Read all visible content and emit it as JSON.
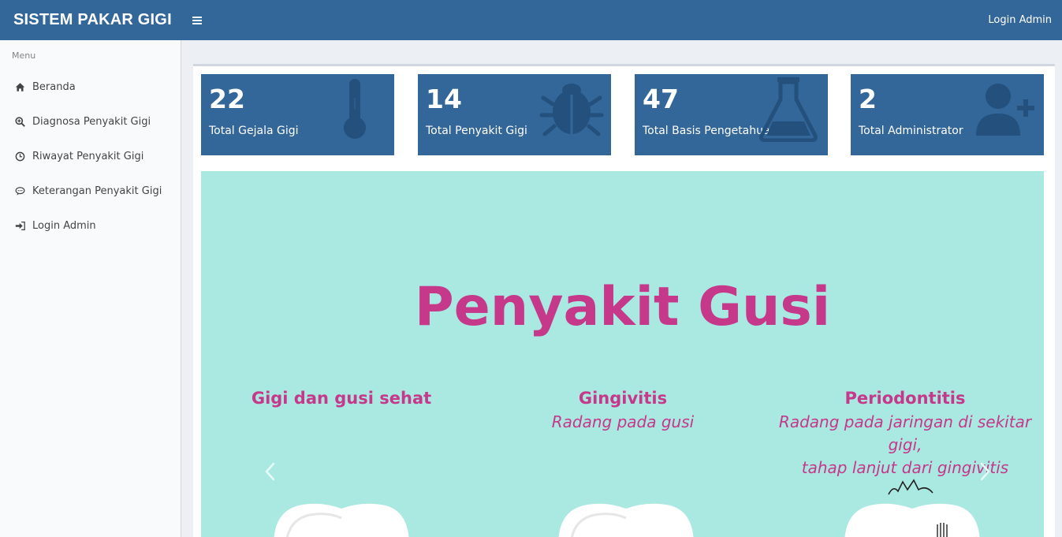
{
  "header": {
    "brand": "SISTEM PAKAR GIGI",
    "login_link": "Login Admin"
  },
  "sidebar": {
    "menu_header": "Menu",
    "items": [
      {
        "label": "Beranda",
        "icon": "home-icon"
      },
      {
        "label": "Diagnosa Penyakit Gigi",
        "icon": "search-plus-icon"
      },
      {
        "label": "Riwayat Penyakit Gigi",
        "icon": "clock-icon"
      },
      {
        "label": "Keterangan Penyakit Gigi",
        "icon": "comment-icon"
      },
      {
        "label": "Login Admin",
        "icon": "sign-in-icon"
      }
    ]
  },
  "stats": [
    {
      "value": "22",
      "label": "Total Gejala Gigi",
      "icon": "thermometer-icon"
    },
    {
      "value": "14",
      "label": "Total Penyakit Gigi",
      "icon": "bug-icon"
    },
    {
      "value": "47",
      "label": "Total Basis Pengetahuan",
      "icon": "flask-icon"
    },
    {
      "value": "2",
      "label": "Total Administrator",
      "icon": "user-plus-icon"
    }
  ],
  "slide": {
    "title": "Penyakit Gusi",
    "columns": [
      {
        "heading": "Gigi dan gusi sehat",
        "lines": []
      },
      {
        "heading": "Gingivitis",
        "lines": [
          "Radang pada gusi"
        ]
      },
      {
        "heading": "Periodontitis",
        "lines": [
          "Radang pada jaringan di sekitar gigi,",
          "tahap lanjut dari gingivitis"
        ]
      }
    ]
  },
  "colors": {
    "primary": "#336699",
    "slide_bg": "#aae8e2",
    "slide_text": "#c5388a"
  }
}
